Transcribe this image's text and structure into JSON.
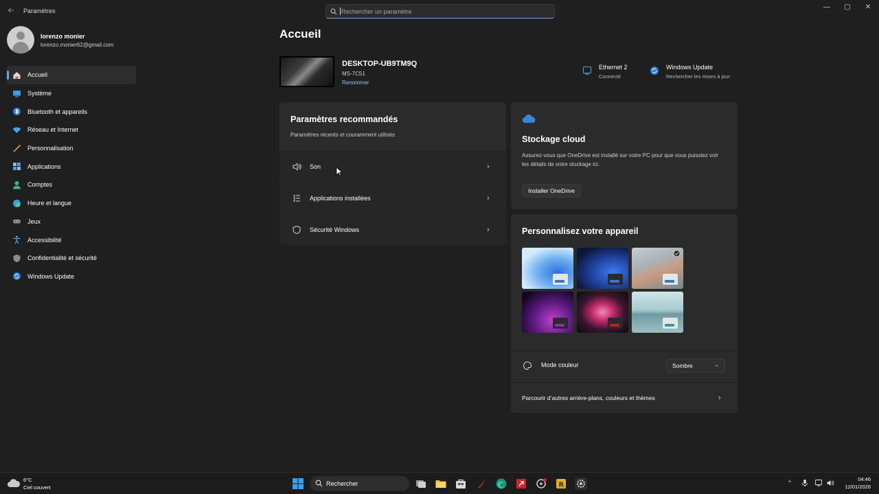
{
  "window": {
    "title": "Paramètres",
    "controls": [
      "—",
      "▢",
      "✕"
    ]
  },
  "search": {
    "placeholder": "Rechercher un paramètre"
  },
  "profile": {
    "name": "lorenzo monier",
    "email": "lorenzo.monier62@gmail.com"
  },
  "sidebar": {
    "items": [
      {
        "label": "Accueil",
        "icon": "home-icon",
        "active": true
      },
      {
        "label": "Système",
        "icon": "system-icon"
      },
      {
        "label": "Bluetooth et appareils",
        "icon": "bluetooth-icon"
      },
      {
        "label": "Réseau et Internet",
        "icon": "wifi-icon"
      },
      {
        "label": "Personnalisation",
        "icon": "brush-icon"
      },
      {
        "label": "Applications",
        "icon": "apps-icon"
      },
      {
        "label": "Comptes",
        "icon": "account-icon"
      },
      {
        "label": "Heure et langue",
        "icon": "globe-clock-icon"
      },
      {
        "label": "Jeux",
        "icon": "gamepad-icon"
      },
      {
        "label": "Accessibilité",
        "icon": "accessibility-icon"
      },
      {
        "label": "Confidentialité et sécurité",
        "icon": "shield-icon"
      },
      {
        "label": "Windows Update",
        "icon": "update-icon"
      }
    ]
  },
  "main": {
    "title": "Accueil",
    "device": {
      "name": "DESKTOP-UB9TM9Q",
      "model": "MS-7C51",
      "rename": "Renommer"
    },
    "status": {
      "ethernet": {
        "title": "Ethernet 2",
        "subtitle": "Connecté"
      },
      "update": {
        "title": "Windows Update",
        "subtitle": "Rechercher les mises à jour"
      }
    },
    "recommended": {
      "title": "Paramètres recommandés",
      "subtitle": "Paramètres récents et couramment utilisés",
      "items": [
        {
          "label": "Son",
          "icon": "speaker-icon"
        },
        {
          "label": "Applications installées",
          "icon": "list-icon"
        },
        {
          "label": "Sécurité Windows",
          "icon": "shield-icon"
        }
      ]
    },
    "cloud": {
      "title": "Stockage cloud",
      "text": "Assurez-vous que OneDrive est installé sur votre PC pour que vous puissiez voir les détails de votre stockage ici.",
      "button": "Installer OneDrive"
    },
    "personalize": {
      "title": "Personnalisez votre appareil",
      "color_mode_label": "Mode couleur",
      "color_mode_value": "Sombre",
      "browse": "Parcourir d’autres arrière-plans, couleurs et thèmes"
    }
  },
  "taskbar": {
    "weather": {
      "temp": "6°C",
      "desc": "Ciel couvert"
    },
    "search_label": "Rechercher",
    "time": "04:46",
    "date": "12/01/2026"
  },
  "colors": {
    "accent": "#60a8ff",
    "link": "#8fc3ff",
    "background": "#1f1f1f",
    "card": "#2b2b2b"
  }
}
